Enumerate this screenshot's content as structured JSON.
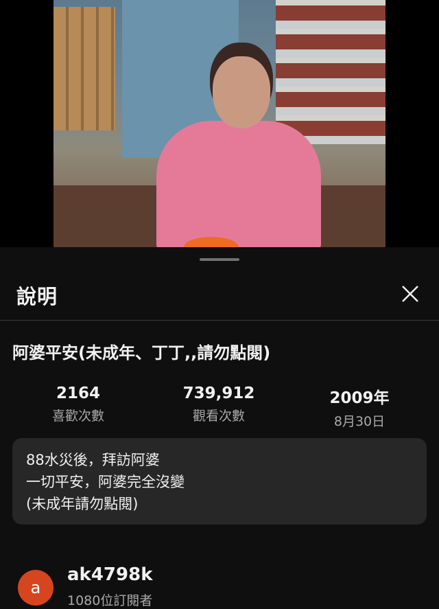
{
  "video": {
    "alt": "video thumbnail"
  },
  "sheet": {
    "title": "說明",
    "close_icon": "close-icon",
    "video_title": "阿婆平安(未成年、丁丁,,請勿點閱)",
    "stats": [
      {
        "value": "2164",
        "label": "喜歡次數"
      },
      {
        "value": "739,912",
        "label": "觀看次數"
      },
      {
        "value": "2009年",
        "label": "8月30日"
      }
    ],
    "description": [
      "88水災後，拜訪阿婆",
      "一切平安，阿婆完全沒變",
      "(未成年請勿點閱)"
    ],
    "channel": {
      "avatar_letter": "a",
      "name": "ak4798k",
      "subscribers": "1080位訂閱者"
    }
  }
}
